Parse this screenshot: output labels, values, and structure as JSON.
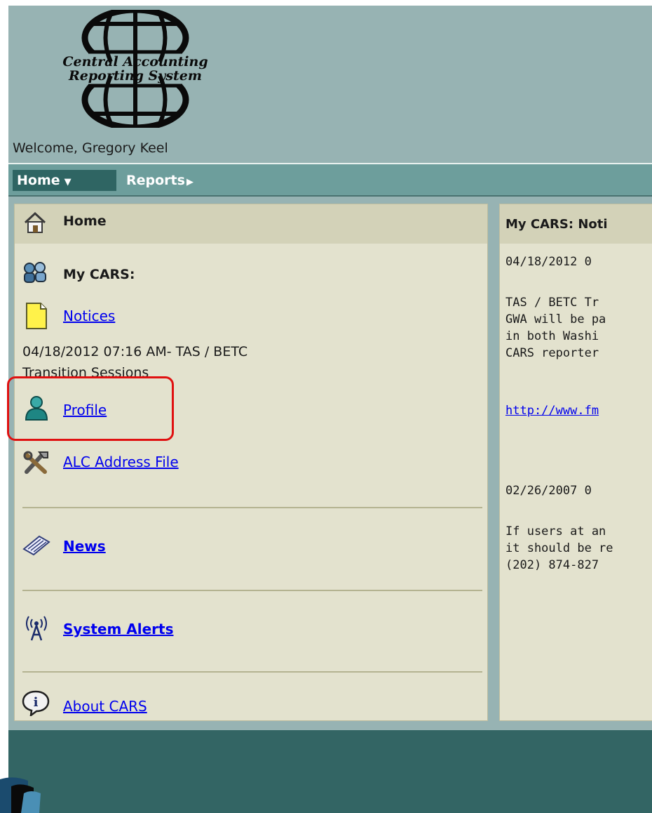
{
  "logo": {
    "line1": "Central Accounting",
    "line2": "Reporting System"
  },
  "welcome": "Welcome, Gregory Keel",
  "nav": {
    "home": "Home",
    "reports": "Reports"
  },
  "left_panel": {
    "title": "Home",
    "my_cars": "My CARS:",
    "notices": "Notices",
    "notice_entry_line1": "04/18/2012 07:16 AM-  TAS / BETC",
    "notice_entry_line2": "Transition Sessions",
    "profile": "Profile",
    "alc_address_file": "ALC Address File",
    "news": "News",
    "system_alerts": "System Alerts",
    "about": "About CARS"
  },
  "right_panel": {
    "title": "My CARS: Noti",
    "lines": [
      "04/18/2012 0",
      "TAS / BETC Tr",
      "GWA will be pa",
      "in both Washi",
      "CARS reporter",
      "http://www.fm",
      "02/26/2007 0",
      "If users at an",
      "it should be re",
      "(202) 874-827"
    ]
  },
  "colors": {
    "accent_highlight": "#e01010",
    "link": "#0000ee",
    "header_bg": "#97b3b3",
    "nav_active": "#2f6563"
  }
}
